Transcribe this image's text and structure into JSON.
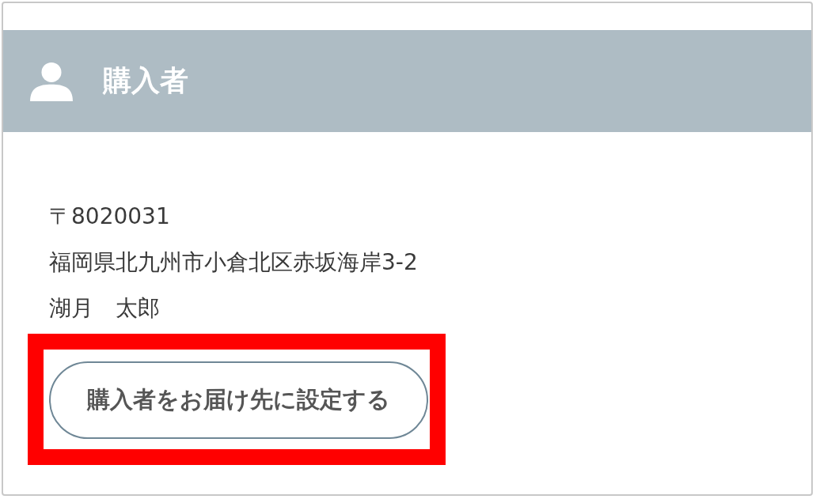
{
  "section": {
    "title": "購入者"
  },
  "address": {
    "postal_code": "〒8020031",
    "street": "福岡県北九州市小倉北区赤坂海岸3-2",
    "name": "湖月　太郎"
  },
  "button": {
    "label": "購入者をお届け先に設定する",
    "highlighted": true
  }
}
